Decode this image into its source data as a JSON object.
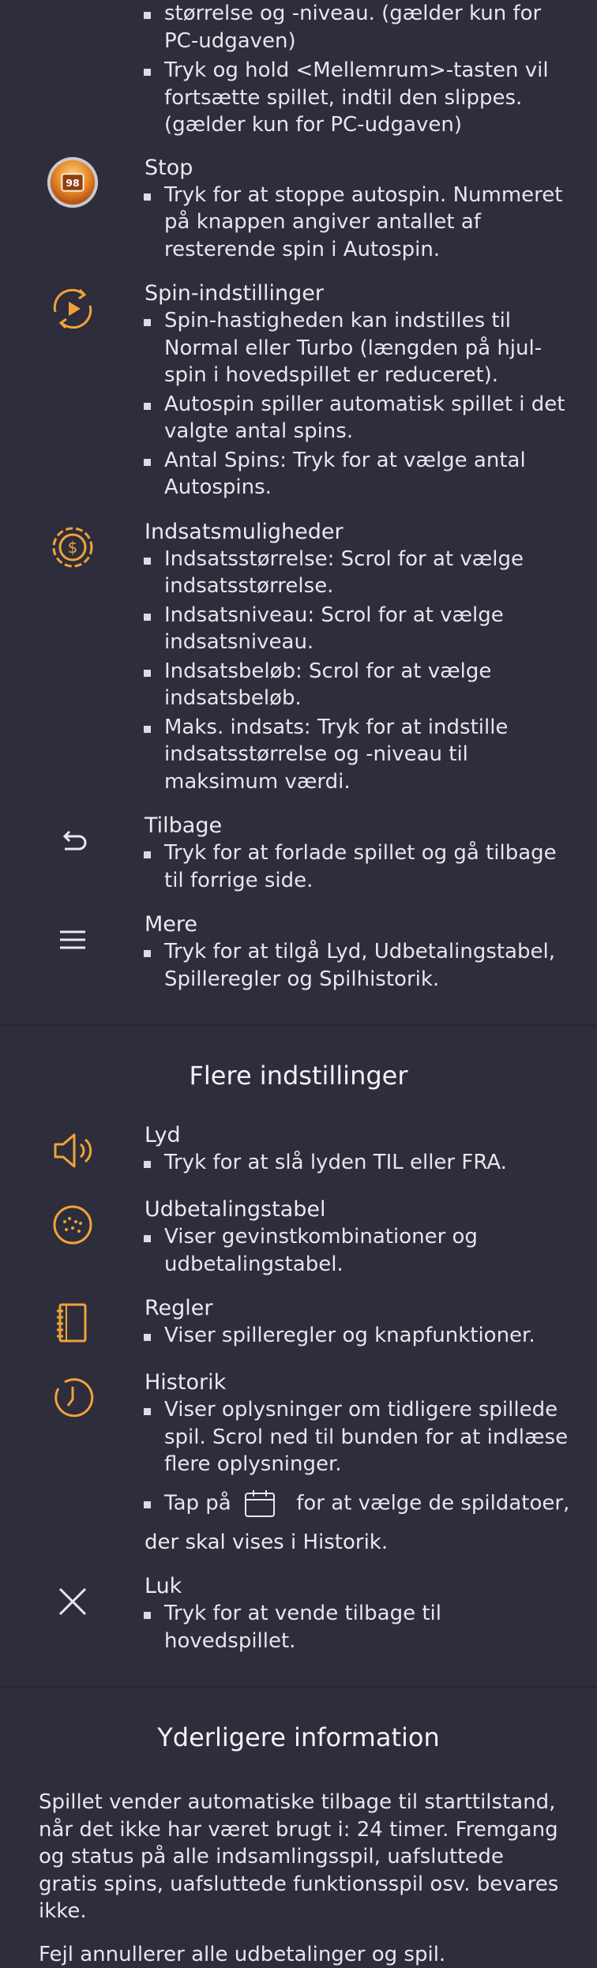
{
  "top_section": {
    "continued_bullets": [
      "størrelse og -niveau. (gælder kun for PC-udgaven)",
      "Tryk og hold <Mellemrum>-tasten vil fortsætte spillet, indtil den slippes. (gælder kun for PC-udgaven)"
    ],
    "items": [
      {
        "title": "Stop",
        "icon": "stop-autospin-icon",
        "icon_badge": "98",
        "bullets": [
          "Tryk for at stoppe autospin. Nummeret på knappen angiver antallet af resterende spin i Autospin."
        ]
      },
      {
        "title": "Spin-indstillinger",
        "icon": "spin-settings-icon",
        "bullets": [
          "Spin-hastigheden kan indstilles til Normal eller Turbo (længden på hjul-spin i hovedspillet er reduceret).",
          "Autospin spiller automatisk spillet i det valgte antal spins.",
          "Antal Spins: Tryk for at vælge antal Autospins."
        ]
      },
      {
        "title": "Indsatsmuligheder",
        "icon": "bet-options-icon",
        "bullets": [
          "Indsatsstørrelse: Scrol for at vælge indsatsstørrelse.",
          "Indsatsniveau: Scrol for at vælge indsatsniveau.",
          "Indsatsbeløb: Scrol for at vælge indsatsbeløb.",
          "Maks. indsats: Tryk for at indstille indsatsstørrelse og -niveau til maksimum værdi."
        ]
      },
      {
        "title": "Tilbage",
        "icon": "back-arrow-icon",
        "bullets": [
          "Tryk for at forlade spillet og gå tilbage til forrige side."
        ]
      },
      {
        "title": "Mere",
        "icon": "menu-icon",
        "bullets": [
          "Tryk for at tilgå Lyd, Udbetalingstabel, Spilleregler og Spilhistorik."
        ]
      }
    ]
  },
  "more_settings": {
    "heading": "Flere indstillinger",
    "items": [
      {
        "title": "Lyd",
        "icon": "speaker-icon",
        "bullets": [
          "Tryk for at slå lyden TIL eller FRA."
        ]
      },
      {
        "title": "Udbetalingstabel",
        "icon": "paytable-icon",
        "bullets": [
          "Viser gevinstkombinationer og udbetalingstabel."
        ]
      },
      {
        "title": "Regler",
        "icon": "rules-notebook-icon",
        "bullets": [
          "Viser spilleregler og knapfunktioner."
        ]
      },
      {
        "title": "Historik",
        "icon": "history-clock-icon",
        "bullets": [
          "Viser oplysninger om tidligere spillede spil. Scrol ned til bunden for at indlæse flere oplysninger."
        ],
        "tap_before": "Tap på",
        "tap_after": "for at vælge de spildatoer,",
        "tap_line2": "der skal vises i Historik."
      },
      {
        "title": "Luk",
        "icon": "close-icon",
        "bullets": [
          "Tryk for at vende tilbage til hovedspillet."
        ]
      }
    ]
  },
  "additional_info": {
    "heading": "Yderligere information",
    "paragraphs": [
      "Spillet vender automatiske tilbage til starttilstand, når det ikke har været brugt i: 24 timer. Fremgang og status på alle indsamlingsspil, uafsluttede gratis spins, uafsluttede funktionsspil osv. bevares ikke.",
      "Fejl annullerer alle udbetalinger og spil."
    ]
  },
  "colors": {
    "background": "#2d2d3b",
    "accent": "#f0a23a",
    "text": "#e6e6ec"
  }
}
